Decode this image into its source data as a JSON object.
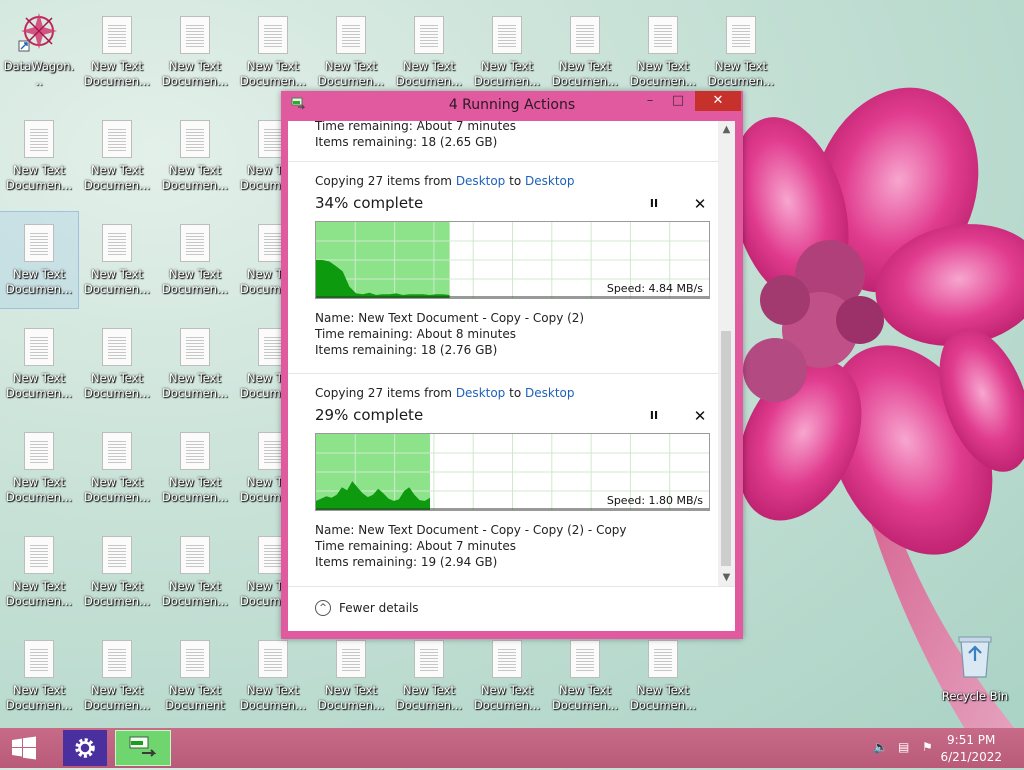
{
  "desktop": {
    "icons": [
      {
        "label": "DataWagon..."
      },
      {
        "label": "New Text Documen..."
      },
      {
        "label": "New Text Documen..."
      },
      {
        "label": "New Text Documen..."
      },
      {
        "label": "New Text Documen..."
      },
      {
        "label": "New Text Documen..."
      },
      {
        "label": "New Text Documen..."
      },
      {
        "label": "New Text Documen..."
      },
      {
        "label": "New Text Documen..."
      },
      {
        "label": "New Text Documen..."
      },
      {
        "label": "New Text Documen..."
      },
      {
        "label": "New Text Documen..."
      },
      {
        "label": "New Text Documen..."
      },
      {
        "label": "New Text Documen..."
      },
      {
        "label": "New Text Documen..."
      },
      {
        "label": "New Text Documen..."
      },
      {
        "label": "New Text Documen..."
      },
      {
        "label": "New Text Documen..."
      },
      {
        "label": "New Text Documen..."
      },
      {
        "label": "New Text Documen..."
      },
      {
        "label": "New Text Documen..."
      },
      {
        "label": "New Text Documen..."
      },
      {
        "label": "New Text Documen..."
      },
      {
        "label": "New Text Documen..."
      },
      {
        "label": "New Text Documen..."
      },
      {
        "label": "New Text Documen..."
      },
      {
        "label": "New Text Documen..."
      },
      {
        "label": "New Text Documen..."
      },
      {
        "label": "New Text Documen..."
      },
      {
        "label": "New Text Documen..."
      },
      {
        "label": "New Text Documen..."
      },
      {
        "label": "New Text Documen..."
      },
      {
        "label": "New Text Document"
      },
      {
        "label": "New Text Documen..."
      },
      {
        "label": "New Text Documen..."
      },
      {
        "label": "New Text Documen..."
      },
      {
        "label": "New Text Documen..."
      },
      {
        "label": "New Text Documen..."
      },
      {
        "label": "New Text Documen..."
      }
    ],
    "recycle_bin_label": "Recycle Bin"
  },
  "window": {
    "title": "4 Running Actions",
    "min_glyph": "–",
    "max_glyph": "□",
    "close_glyph": "✕",
    "partial_op": {
      "time_remaining": "Time remaining:  About 7 minutes",
      "items_remaining": "Items remaining:  18 (2.65 GB)"
    },
    "ops": [
      {
        "copying_prefix": "Copying 27 items from ",
        "source": "Desktop",
        "to_word": " to ",
        "dest": "Desktop",
        "percent_text": "34% complete",
        "percent": 34,
        "speed": "Speed: 4.84 MB/s",
        "name": "Name:  New Text Document - Copy - Copy (2)",
        "time_remaining": "Time remaining:  About 8 minutes",
        "items_remaining": "Items remaining:  18 (2.76 GB)"
      },
      {
        "copying_prefix": "Copying 27 items from ",
        "source": "Desktop",
        "to_word": " to ",
        "dest": "Desktop",
        "percent_text": "29% complete",
        "percent": 29,
        "speed": "Speed: 1.80 MB/s",
        "name": "Name:  New Text Document - Copy - Copy (2) - Copy",
        "time_remaining": "Time remaining:  About 7 minutes",
        "items_remaining": "Items remaining:  19 (2.94 GB)"
      }
    ],
    "pause_glyph": "II",
    "cancel_glyph": "✕",
    "fewer_details": "Fewer details"
  },
  "taskbar": {
    "time": "9:51 PM",
    "date": "6/21/2022"
  },
  "colors": {
    "window_frame": "#e15a9f",
    "close_button": "#c7312b",
    "graph_fill": "#8de38a",
    "graph_line": "#0e9a0e",
    "link": "#1d62b8"
  }
}
